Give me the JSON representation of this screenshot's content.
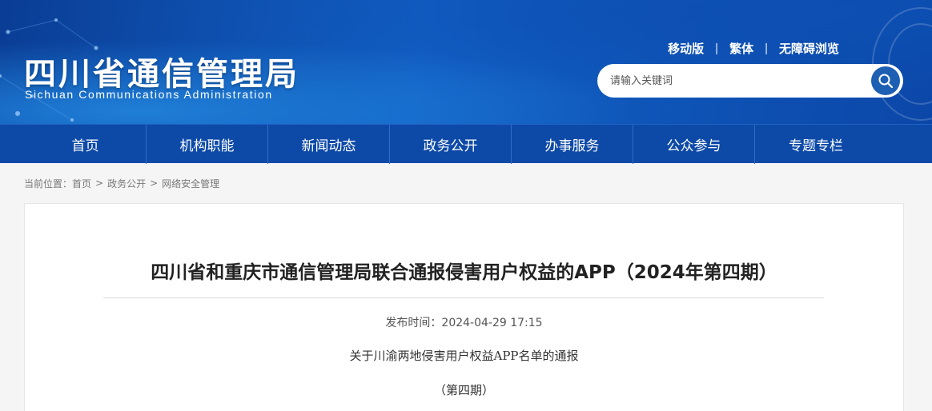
{
  "header": {
    "title_cn": "四川省通信管理局",
    "title_en": "Sichuan Communications Administration",
    "links": [
      "移动版",
      "繁体",
      "无障碍浏览"
    ],
    "search": {
      "placeholder": "请输入关键词"
    },
    "icons": {
      "search": "search-icon"
    }
  },
  "nav": {
    "items": [
      "首页",
      "机构职能",
      "新闻动态",
      "政务公开",
      "办事服务",
      "公众参与",
      "专题专栏"
    ]
  },
  "breadcrumb": {
    "label": "当前位置：",
    "items": [
      "首页",
      "政务公开",
      "网络安全管理"
    ],
    "separator": ">"
  },
  "article": {
    "title": "四川省和重庆市通信管理局联合通报侵害用户权益的APP（2024年第四期）",
    "date": "发布时间：2024-04-29 17:15",
    "subtitle": "关于川渝两地侵害用户权益APP名单的通报",
    "issue": "（第四期）"
  },
  "colors": {
    "nav_bg": "#0d4aa8",
    "header_bg": "#1260c5",
    "search_button": "#1d5fb3"
  }
}
